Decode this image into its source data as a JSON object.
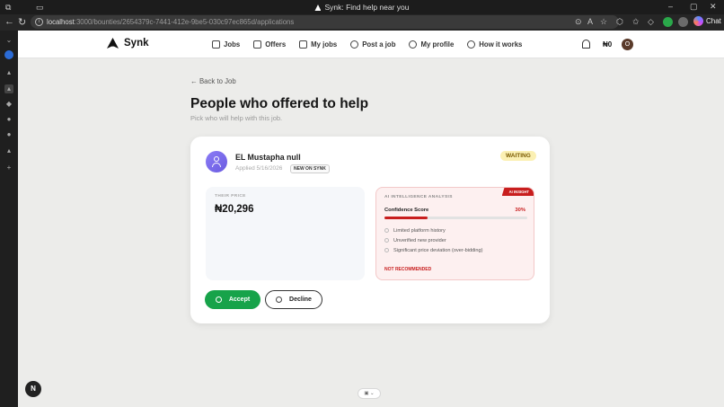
{
  "browser": {
    "window_title": "Synk: Find help near you",
    "url_host": "localhost",
    "url_rest": ":3000/bounties/2654379c-7441-412e-9be5-030c97ec865d/applications",
    "chat_label": "Chat"
  },
  "nav": {
    "brand": "Synk",
    "links": [
      {
        "label": "Jobs",
        "icon": "home-icon"
      },
      {
        "label": "Offers",
        "icon": "briefcase-icon"
      },
      {
        "label": "My jobs",
        "icon": "document-icon"
      },
      {
        "label": "Post a job",
        "icon": "plus-circle-icon"
      },
      {
        "label": "My profile",
        "icon": "user-icon"
      },
      {
        "label": "How it works",
        "icon": "help-icon"
      }
    ],
    "balance": "₦0",
    "avatar_initial": "O"
  },
  "page": {
    "back_link": "← Back to Job",
    "title": "People who offered to help",
    "subtitle": "Pick who will help with this job."
  },
  "application": {
    "name": "EL Mustapha null",
    "applied": "Applied 5/16/2026",
    "badge": "NEW ON SYNK",
    "status": "WAITING",
    "price_label": "THEIR PRICE",
    "price": "₦20,296",
    "ai": {
      "label": "AI INTELLIGENCE ANALYSIS",
      "flag": "AI INSIGHT",
      "confidence_label": "Confidence Score",
      "confidence_text": "30%",
      "confidence_value": 30,
      "reasons": [
        "Limited platform history",
        "Unverified new provider",
        "Significant price deviation (over-bidding)"
      ],
      "verdict": "NOT RECOMMENDED",
      "accent": "#c81e1e"
    },
    "accept_label": "Accept",
    "decline_label": "Decline"
  },
  "dev": {
    "badge": "N"
  },
  "colors": {
    "accept_green": "#17a34a",
    "waiting_bg": "#fbf0b3",
    "avatar_purple": "#8b7cf6"
  }
}
